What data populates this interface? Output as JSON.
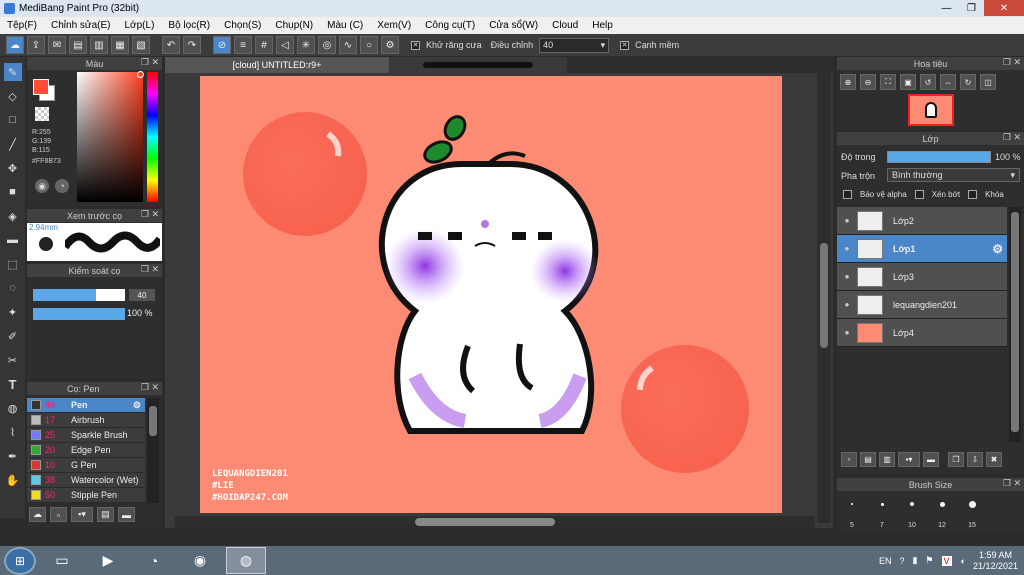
{
  "window": {
    "title": "MediBang Paint Pro (32bit)"
  },
  "menu": [
    "Tệp(F)",
    "Chỉnh sửa(E)",
    "Lớp(L)",
    "Bộ lọc(R)",
    "Chọn(S)",
    "Chụp(N)",
    "Màu (C)",
    "Xem(V)",
    "Công cụ(T)",
    "Cửa sổ(W)",
    "Cloud",
    "Help"
  ],
  "toolbar": {
    "antialias_label": "Khử răng cưa",
    "adjust_label": "Điều chỉnh",
    "adjust_value": "40",
    "edge_label": "Cạnh mềm"
  },
  "color_panel": {
    "title": "Màu",
    "r": "R:255",
    "g": "G:139",
    "b": "B:115",
    "hex": "#FF8B73",
    "primary": "#ff8b73"
  },
  "brush_preview": {
    "title": "Xem trước cọ",
    "size": "2.94mm"
  },
  "brush_control": {
    "title": "Kiểm soát cọ",
    "size_value": "40",
    "opacity_value": "100 %",
    "size_fraction": 0.68,
    "opacity_fraction": 1.0
  },
  "brush_list": {
    "title": "Cọ: Pen",
    "items": [
      {
        "size": "40",
        "name": "Pen",
        "color": "#333333",
        "selected": true
      },
      {
        "size": "17",
        "name": "Airbrush",
        "color": "#bbbbbb"
      },
      {
        "size": "25",
        "name": "Sparkle Brush",
        "color": "#7777ff"
      },
      {
        "size": "20",
        "name": "Edge Pen",
        "color": "#33aa33"
      },
      {
        "size": "10",
        "name": "G Pen",
        "color": "#dd3333"
      },
      {
        "size": "38",
        "name": "Watercolor (Wet)",
        "color": "#55ccee"
      },
      {
        "size": "50",
        "name": "Stipple Pen",
        "color": "#eedd22"
      }
    ]
  },
  "canvas": {
    "tab_label": "[cloud] UNTITLED:r9+",
    "bg": "#fd8b73",
    "watermark": [
      "LEQUANGDIEN201",
      "#LIE",
      "#HOIDAP247.COM"
    ]
  },
  "navigator": {
    "title": "Hoa tiêu"
  },
  "layer_panel": {
    "title": "Lớp",
    "opacity_label": "Độ trong",
    "opacity_value": "100 %",
    "opacity_fraction": 1.0,
    "blend_label": "Pha trộn",
    "blend_value": "Bình thường",
    "protect_alpha": "Bảo vệ alpha",
    "clipping": "Xén bớt",
    "lock": "Khóa",
    "layers": [
      {
        "name": "Lớp2",
        "selected": false
      },
      {
        "name": "Lớp1",
        "selected": true
      },
      {
        "name": "Lớp3",
        "selected": false
      },
      {
        "name": "lequangdien201",
        "selected": false
      },
      {
        "name": "Lớp4",
        "selected": false
      }
    ]
  },
  "brush_size": {
    "title": "Brush Size",
    "sizes": [
      "5",
      "7",
      "10",
      "12",
      "15"
    ]
  },
  "taskbar": {
    "lang": "EN",
    "time": "1:59 AM",
    "date": "21/12/2021"
  }
}
